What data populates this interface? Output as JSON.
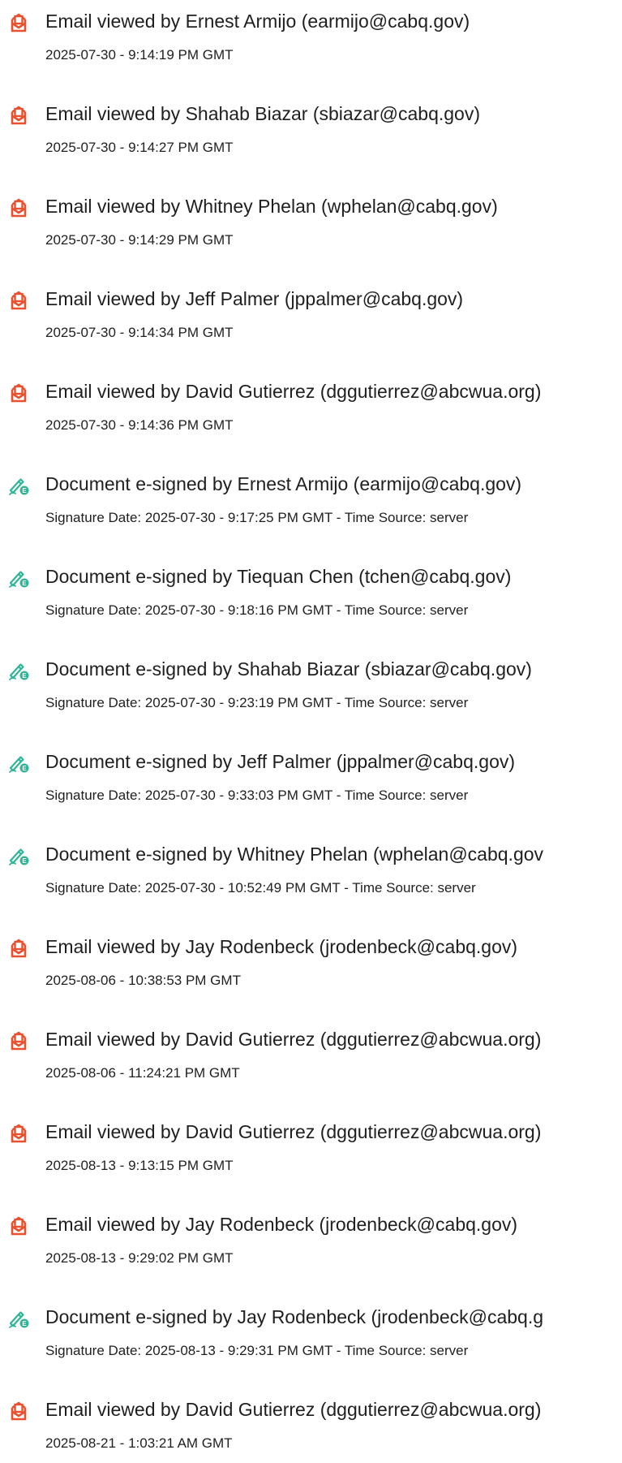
{
  "colors": {
    "email_icon": "#e8502e",
    "esign_icon": "#2fb596",
    "text": "#1f1f1f"
  },
  "events": [
    {
      "type": "email-viewed",
      "icon": "email-viewed-icon",
      "title": "Email viewed by Ernest Armijo (earmijo@cabq.gov)",
      "date": "2025-07-30 - 9:14:19 PM GMT"
    },
    {
      "type": "email-viewed",
      "icon": "email-viewed-icon",
      "title": "Email viewed by Shahab Biazar (sbiazar@cabq.gov)",
      "date": "2025-07-30 - 9:14:27 PM GMT"
    },
    {
      "type": "email-viewed",
      "icon": "email-viewed-icon",
      "title": "Email viewed by Whitney Phelan (wphelan@cabq.gov)",
      "date": "2025-07-30 - 9:14:29 PM GMT"
    },
    {
      "type": "email-viewed",
      "icon": "email-viewed-icon",
      "title": "Email viewed by Jeff Palmer (jppalmer@cabq.gov)",
      "date": "2025-07-30 - 9:14:34 PM GMT"
    },
    {
      "type": "email-viewed",
      "icon": "email-viewed-icon",
      "title": "Email viewed by David Gutierrez (dggutierrez@abcwua.org)",
      "date": "2025-07-30 - 9:14:36 PM GMT"
    },
    {
      "type": "e-signed",
      "icon": "e-signature-icon",
      "title": "Document e-signed by Ernest Armijo (earmijo@cabq.gov)",
      "date": "Signature Date: 2025-07-30 - 9:17:25 PM GMT - Time Source: server"
    },
    {
      "type": "e-signed",
      "icon": "e-signature-icon",
      "title": "Document e-signed by Tiequan Chen (tchen@cabq.gov)",
      "date": "Signature Date: 2025-07-30 - 9:18:16 PM GMT - Time Source: server"
    },
    {
      "type": "e-signed",
      "icon": "e-signature-icon",
      "title": "Document e-signed by Shahab Biazar (sbiazar@cabq.gov)",
      "date": "Signature Date: 2025-07-30 - 9:23:19 PM GMT - Time Source: server"
    },
    {
      "type": "e-signed",
      "icon": "e-signature-icon",
      "title": "Document e-signed by Jeff Palmer (jppalmer@cabq.gov)",
      "date": "Signature Date: 2025-07-30 - 9:33:03 PM GMT - Time Source: server"
    },
    {
      "type": "e-signed",
      "icon": "e-signature-icon",
      "title": "Document e-signed by Whitney Phelan (wphelan@cabq.gov",
      "date": "Signature Date: 2025-07-30 - 10:52:49 PM GMT - Time Source: server"
    },
    {
      "type": "email-viewed",
      "icon": "email-viewed-icon",
      "title": "Email viewed by Jay Rodenbeck (jrodenbeck@cabq.gov)",
      "date": "2025-08-06 - 10:38:53 PM GMT"
    },
    {
      "type": "email-viewed",
      "icon": "email-viewed-icon",
      "title": "Email viewed by David Gutierrez (dggutierrez@abcwua.org)",
      "date": "2025-08-06 - 11:24:21 PM GMT"
    },
    {
      "type": "email-viewed",
      "icon": "email-viewed-icon",
      "title": "Email viewed by David Gutierrez (dggutierrez@abcwua.org)",
      "date": "2025-08-13 - 9:13:15 PM GMT"
    },
    {
      "type": "email-viewed",
      "icon": "email-viewed-icon",
      "title": "Email viewed by Jay Rodenbeck (jrodenbeck@cabq.gov)",
      "date": "2025-08-13 - 9:29:02 PM GMT"
    },
    {
      "type": "e-signed",
      "icon": "e-signature-icon",
      "title": "Document e-signed by Jay Rodenbeck (jrodenbeck@cabq.g",
      "date": "Signature Date: 2025-08-13 - 9:29:31 PM GMT - Time Source: server"
    },
    {
      "type": "email-viewed",
      "icon": "email-viewed-icon",
      "title": "Email viewed by David Gutierrez (dggutierrez@abcwua.org)",
      "date": "2025-08-21 - 1:03:21 AM GMT"
    }
  ]
}
